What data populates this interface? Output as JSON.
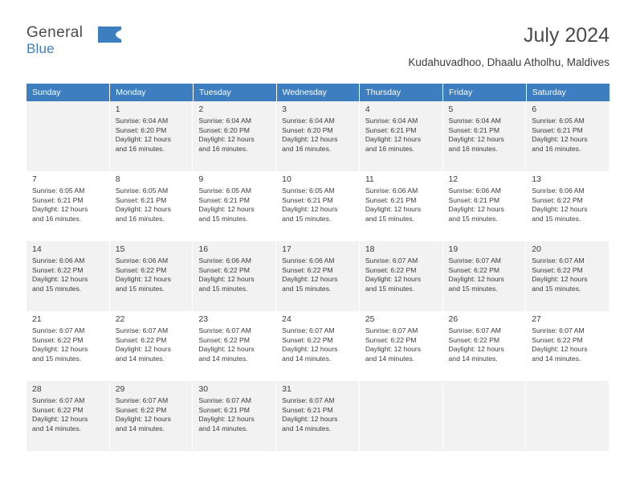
{
  "logo": {
    "word_general": "General",
    "word_blue": "Blue",
    "flag_icon": "blue-flag-icon"
  },
  "header": {
    "title": "July 2024",
    "location": "Kudahuvadhoo, Dhaalu Atholhu, Maldives"
  },
  "colors": {
    "header_blue": "#3d7ec0",
    "row_shade": "#f2f2f2",
    "text": "#3b3b3b"
  },
  "calendar": {
    "weekdays": [
      "Sunday",
      "Monday",
      "Tuesday",
      "Wednesday",
      "Thursday",
      "Friday",
      "Saturday"
    ],
    "weeks": [
      [
        {
          "day": "",
          "sunrise": "",
          "sunset": "",
          "daylight1": "",
          "daylight2": ""
        },
        {
          "day": "1",
          "sunrise": "Sunrise: 6:04 AM",
          "sunset": "Sunset: 6:20 PM",
          "daylight1": "Daylight: 12 hours",
          "daylight2": "and 16 minutes."
        },
        {
          "day": "2",
          "sunrise": "Sunrise: 6:04 AM",
          "sunset": "Sunset: 6:20 PM",
          "daylight1": "Daylight: 12 hours",
          "daylight2": "and 16 minutes."
        },
        {
          "day": "3",
          "sunrise": "Sunrise: 6:04 AM",
          "sunset": "Sunset: 6:20 PM",
          "daylight1": "Daylight: 12 hours",
          "daylight2": "and 16 minutes."
        },
        {
          "day": "4",
          "sunrise": "Sunrise: 6:04 AM",
          "sunset": "Sunset: 6:21 PM",
          "daylight1": "Daylight: 12 hours",
          "daylight2": "and 16 minutes."
        },
        {
          "day": "5",
          "sunrise": "Sunrise: 6:04 AM",
          "sunset": "Sunset: 6:21 PM",
          "daylight1": "Daylight: 12 hours",
          "daylight2": "and 16 minutes."
        },
        {
          "day": "6",
          "sunrise": "Sunrise: 6:05 AM",
          "sunset": "Sunset: 6:21 PM",
          "daylight1": "Daylight: 12 hours",
          "daylight2": "and 16 minutes."
        }
      ],
      [
        {
          "day": "7",
          "sunrise": "Sunrise: 6:05 AM",
          "sunset": "Sunset: 6:21 PM",
          "daylight1": "Daylight: 12 hours",
          "daylight2": "and 16 minutes."
        },
        {
          "day": "8",
          "sunrise": "Sunrise: 6:05 AM",
          "sunset": "Sunset: 6:21 PM",
          "daylight1": "Daylight: 12 hours",
          "daylight2": "and 16 minutes."
        },
        {
          "day": "9",
          "sunrise": "Sunrise: 6:05 AM",
          "sunset": "Sunset: 6:21 PM",
          "daylight1": "Daylight: 12 hours",
          "daylight2": "and 15 minutes."
        },
        {
          "day": "10",
          "sunrise": "Sunrise: 6:05 AM",
          "sunset": "Sunset: 6:21 PM",
          "daylight1": "Daylight: 12 hours",
          "daylight2": "and 15 minutes."
        },
        {
          "day": "11",
          "sunrise": "Sunrise: 6:06 AM",
          "sunset": "Sunset: 6:21 PM",
          "daylight1": "Daylight: 12 hours",
          "daylight2": "and 15 minutes."
        },
        {
          "day": "12",
          "sunrise": "Sunrise: 6:06 AM",
          "sunset": "Sunset: 6:21 PM",
          "daylight1": "Daylight: 12 hours",
          "daylight2": "and 15 minutes."
        },
        {
          "day": "13",
          "sunrise": "Sunrise: 6:06 AM",
          "sunset": "Sunset: 6:22 PM",
          "daylight1": "Daylight: 12 hours",
          "daylight2": "and 15 minutes."
        }
      ],
      [
        {
          "day": "14",
          "sunrise": "Sunrise: 6:06 AM",
          "sunset": "Sunset: 6:22 PM",
          "daylight1": "Daylight: 12 hours",
          "daylight2": "and 15 minutes."
        },
        {
          "day": "15",
          "sunrise": "Sunrise: 6:06 AM",
          "sunset": "Sunset: 6:22 PM",
          "daylight1": "Daylight: 12 hours",
          "daylight2": "and 15 minutes."
        },
        {
          "day": "16",
          "sunrise": "Sunrise: 6:06 AM",
          "sunset": "Sunset: 6:22 PM",
          "daylight1": "Daylight: 12 hours",
          "daylight2": "and 15 minutes."
        },
        {
          "day": "17",
          "sunrise": "Sunrise: 6:06 AM",
          "sunset": "Sunset: 6:22 PM",
          "daylight1": "Daylight: 12 hours",
          "daylight2": "and 15 minutes."
        },
        {
          "day": "18",
          "sunrise": "Sunrise: 6:07 AM",
          "sunset": "Sunset: 6:22 PM",
          "daylight1": "Daylight: 12 hours",
          "daylight2": "and 15 minutes."
        },
        {
          "day": "19",
          "sunrise": "Sunrise: 6:07 AM",
          "sunset": "Sunset: 6:22 PM",
          "daylight1": "Daylight: 12 hours",
          "daylight2": "and 15 minutes."
        },
        {
          "day": "20",
          "sunrise": "Sunrise: 6:07 AM",
          "sunset": "Sunset: 6:22 PM",
          "daylight1": "Daylight: 12 hours",
          "daylight2": "and 15 minutes."
        }
      ],
      [
        {
          "day": "21",
          "sunrise": "Sunrise: 6:07 AM",
          "sunset": "Sunset: 6:22 PM",
          "daylight1": "Daylight: 12 hours",
          "daylight2": "and 15 minutes."
        },
        {
          "day": "22",
          "sunrise": "Sunrise: 6:07 AM",
          "sunset": "Sunset: 6:22 PM",
          "daylight1": "Daylight: 12 hours",
          "daylight2": "and 14 minutes."
        },
        {
          "day": "23",
          "sunrise": "Sunrise: 6:07 AM",
          "sunset": "Sunset: 6:22 PM",
          "daylight1": "Daylight: 12 hours",
          "daylight2": "and 14 minutes."
        },
        {
          "day": "24",
          "sunrise": "Sunrise: 6:07 AM",
          "sunset": "Sunset: 6:22 PM",
          "daylight1": "Daylight: 12 hours",
          "daylight2": "and 14 minutes."
        },
        {
          "day": "25",
          "sunrise": "Sunrise: 6:07 AM",
          "sunset": "Sunset: 6:22 PM",
          "daylight1": "Daylight: 12 hours",
          "daylight2": "and 14 minutes."
        },
        {
          "day": "26",
          "sunrise": "Sunrise: 6:07 AM",
          "sunset": "Sunset: 6:22 PM",
          "daylight1": "Daylight: 12 hours",
          "daylight2": "and 14 minutes."
        },
        {
          "day": "27",
          "sunrise": "Sunrise: 6:07 AM",
          "sunset": "Sunset: 6:22 PM",
          "daylight1": "Daylight: 12 hours",
          "daylight2": "and 14 minutes."
        }
      ],
      [
        {
          "day": "28",
          "sunrise": "Sunrise: 6:07 AM",
          "sunset": "Sunset: 6:22 PM",
          "daylight1": "Daylight: 12 hours",
          "daylight2": "and 14 minutes."
        },
        {
          "day": "29",
          "sunrise": "Sunrise: 6:07 AM",
          "sunset": "Sunset: 6:22 PM",
          "daylight1": "Daylight: 12 hours",
          "daylight2": "and 14 minutes."
        },
        {
          "day": "30",
          "sunrise": "Sunrise: 6:07 AM",
          "sunset": "Sunset: 6:21 PM",
          "daylight1": "Daylight: 12 hours",
          "daylight2": "and 14 minutes."
        },
        {
          "day": "31",
          "sunrise": "Sunrise: 6:07 AM",
          "sunset": "Sunset: 6:21 PM",
          "daylight1": "Daylight: 12 hours",
          "daylight2": "and 14 minutes."
        },
        {
          "day": "",
          "sunrise": "",
          "sunset": "",
          "daylight1": "",
          "daylight2": ""
        },
        {
          "day": "",
          "sunrise": "",
          "sunset": "",
          "daylight1": "",
          "daylight2": ""
        },
        {
          "day": "",
          "sunrise": "",
          "sunset": "",
          "daylight1": "",
          "daylight2": ""
        }
      ]
    ]
  }
}
